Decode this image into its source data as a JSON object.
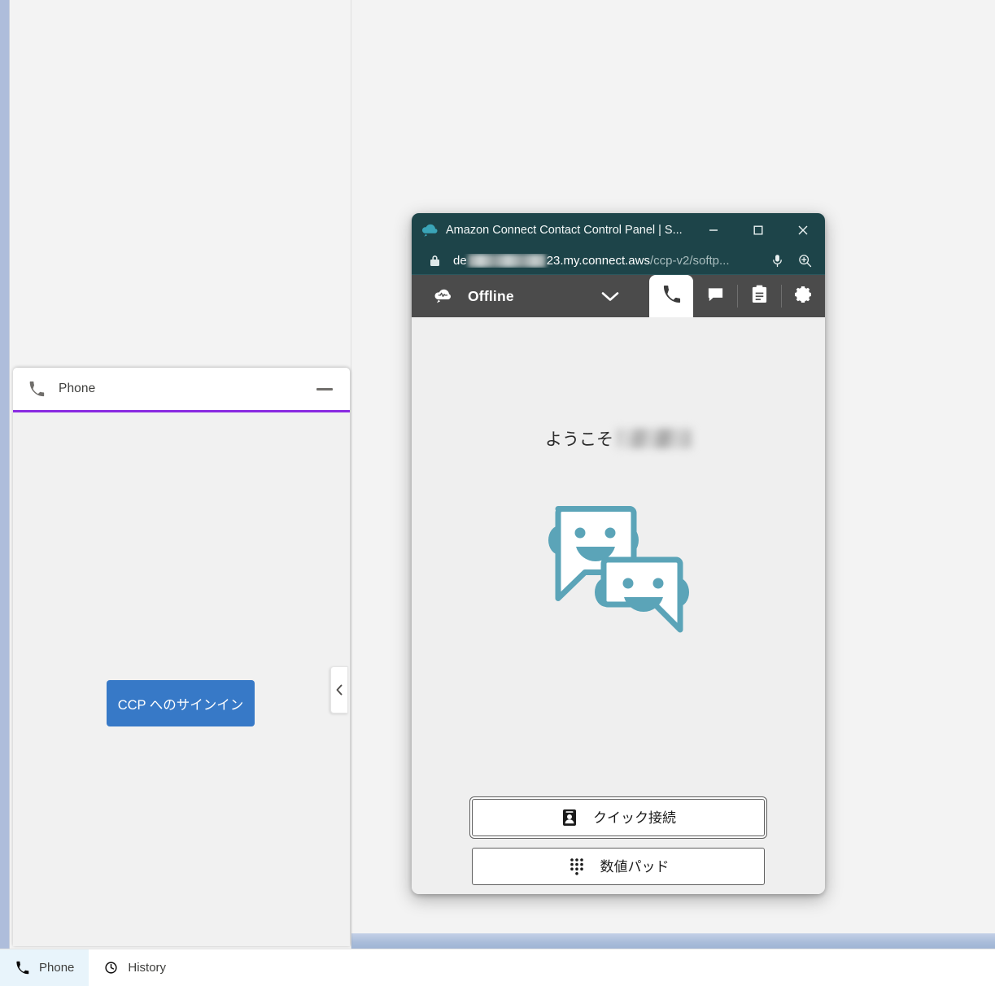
{
  "console": {
    "phone_panel": {
      "title": "Phone",
      "icon": "phone-icon",
      "minimize_icon": "minimize-icon",
      "signin_button": "CCP へのサインイン",
      "accent_color": "#8a2be2"
    },
    "collapse_handle": {
      "icon": "chevron-left-icon"
    },
    "utility_bar": {
      "items": [
        {
          "label": "Phone",
          "icon": "phone-icon",
          "active": true
        },
        {
          "label": "History",
          "icon": "clock-icon",
          "active": false
        }
      ]
    }
  },
  "ccp_window": {
    "titlebar": {
      "favicon": "amazon-connect-cloud-icon",
      "title": "Amazon Connect Contact Control Panel | S...",
      "minimize_label": "minimize-icon",
      "maximize_label": "maximize-icon",
      "close_label": "close-icon",
      "background_color": "#1d4449"
    },
    "urlbar": {
      "lock_icon": "lock-icon",
      "host_prefix": "de",
      "host_redacted": true,
      "host_suffix": "23.my.connect.aws",
      "path": "/ccp-v2/softp...",
      "mic_icon": "microphone-icon",
      "zoom_icon": "zoom-in-icon"
    },
    "appbar": {
      "logo_icon": "amazon-connect-logo-icon",
      "status": "Offline",
      "status_caret_icon": "chevron-down-icon",
      "tabs": [
        {
          "name": "phone",
          "icon": "phone-icon",
          "active": true
        },
        {
          "name": "chat",
          "icon": "chat-bubble-icon",
          "active": false
        },
        {
          "name": "tasks",
          "icon": "clipboard-icon",
          "active": false
        },
        {
          "name": "settings",
          "icon": "gear-icon",
          "active": false
        }
      ]
    },
    "content": {
      "welcome_prefix": "ようこそ",
      "welcome_name_redacted": true,
      "mascot_icon": "two-smiling-speech-bubbles-icon",
      "mascot_color": "#5ba4b8",
      "actions": [
        {
          "label": "クイック接続",
          "icon": "contact-card-icon",
          "focused": true
        },
        {
          "label": "数値パッド",
          "icon": "dialpad-icon",
          "focused": false
        }
      ]
    }
  }
}
